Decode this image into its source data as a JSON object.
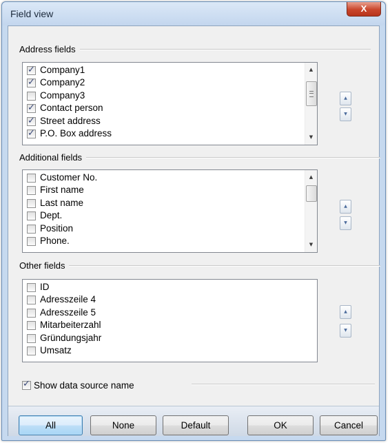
{
  "window": {
    "title": "Field view",
    "close_glyph": "X"
  },
  "address_fields": {
    "label": "Address fields",
    "items": [
      {
        "label": "Company1",
        "checked": true
      },
      {
        "label": "Company2",
        "checked": true
      },
      {
        "label": "Company3",
        "checked": false
      },
      {
        "label": "Contact person",
        "checked": true
      },
      {
        "label": "Street address",
        "checked": true
      },
      {
        "label": "P.O. Box address",
        "checked": true
      }
    ]
  },
  "additional_fields": {
    "label": "Additional fields",
    "items": [
      {
        "label": "Customer No.",
        "checked": false
      },
      {
        "label": "First name",
        "checked": false
      },
      {
        "label": "Last name",
        "checked": false
      },
      {
        "label": "Dept.",
        "checked": false
      },
      {
        "label": "Position",
        "checked": false
      },
      {
        "label": "Phone.",
        "checked": false
      }
    ]
  },
  "other_fields": {
    "label": "Other fields",
    "items": [
      {
        "label": "ID",
        "checked": false
      },
      {
        "label": "Adresszeile 4",
        "checked": false
      },
      {
        "label": "Adresszeile 5",
        "checked": false
      },
      {
        "label": "Mitarbeiterzahl",
        "checked": false
      },
      {
        "label": "Gründungsjahr",
        "checked": false
      },
      {
        "label": "Umsatz",
        "checked": false
      }
    ]
  },
  "show_data_source": {
    "label": "Show data source name",
    "checked": true
  },
  "icons": {
    "scroll_up": "▲",
    "scroll_down": "▼",
    "move_up": "▲",
    "move_down": "▼",
    "check": "checkmark-icon"
  },
  "buttons": {
    "all": "All",
    "none": "None",
    "default": "Default",
    "ok": "OK",
    "cancel": "Cancel"
  },
  "colors": {
    "client_bg": "#f0f0f0",
    "frame": "#c6d9ef",
    "close": "#c9462c",
    "focus_button": "#bedef7"
  }
}
